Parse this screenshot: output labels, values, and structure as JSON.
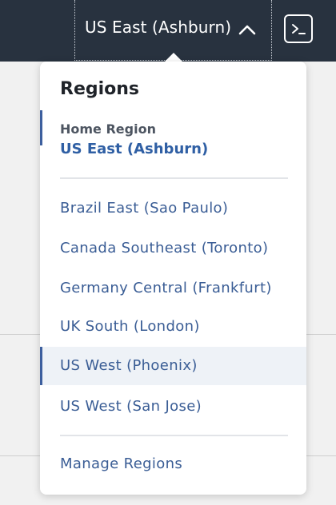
{
  "header": {
    "region_selector_label": "US East (Ashburn)"
  },
  "dropdown": {
    "title": "Regions",
    "home_region": {
      "caption": "Home Region",
      "value": "US East (Ashburn)"
    },
    "regions": [
      {
        "label": "Brazil East (Sao Paulo)",
        "selected": false
      },
      {
        "label": "Canada Southeast (Toronto)",
        "selected": false
      },
      {
        "label": "Germany Central (Frankfurt)",
        "selected": false
      },
      {
        "label": "UK South (London)",
        "selected": false
      },
      {
        "label": "US West (Phoenix)",
        "selected": true
      },
      {
        "label": "US West (San Jose)",
        "selected": false
      }
    ],
    "manage_label": "Manage Regions"
  },
  "icons": {
    "chevron": "chevron-up-icon",
    "shell": "cloud-shell-icon"
  },
  "colors": {
    "topbar": "#28323f",
    "accent": "#3d5f9e",
    "link": "#3a5d95"
  }
}
